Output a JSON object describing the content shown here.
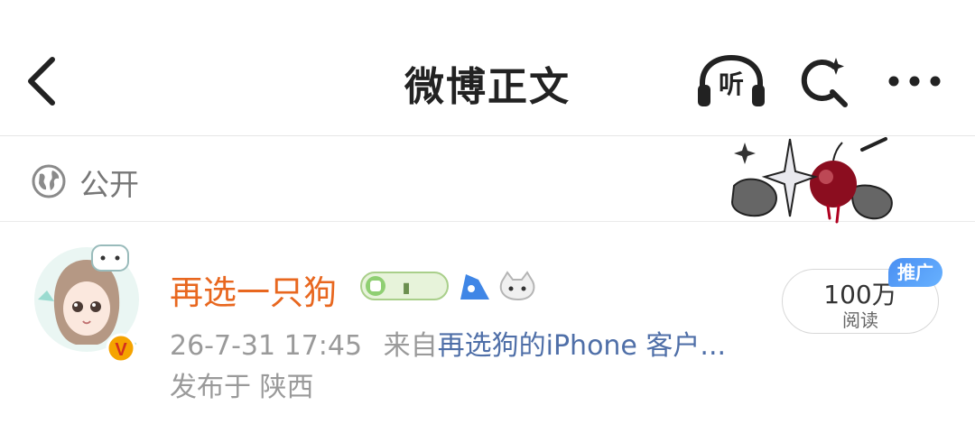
{
  "header": {
    "title": "微博正文",
    "listen_label": "听"
  },
  "visibility": {
    "label": "公开"
  },
  "post": {
    "author_name": "再选一只狗",
    "timestamp": "26-7-31 17:45",
    "source_prefix": "来自",
    "source_name": "再选狗的iPhone 客户...",
    "location": "发布于 陕西",
    "read_count": "100万",
    "read_label": "阅读",
    "promo_tag": "推广"
  },
  "colors": {
    "author_name": "#e8671f",
    "source_link": "#4f6fa8",
    "promo_tag": "#4a8ff2",
    "verified_badge": "#f5a300"
  },
  "icons": [
    "back-arrow-icon",
    "headphones-icon",
    "search-spark-icon",
    "more-dots-icon",
    "globe-icon",
    "verified-v-icon"
  ]
}
